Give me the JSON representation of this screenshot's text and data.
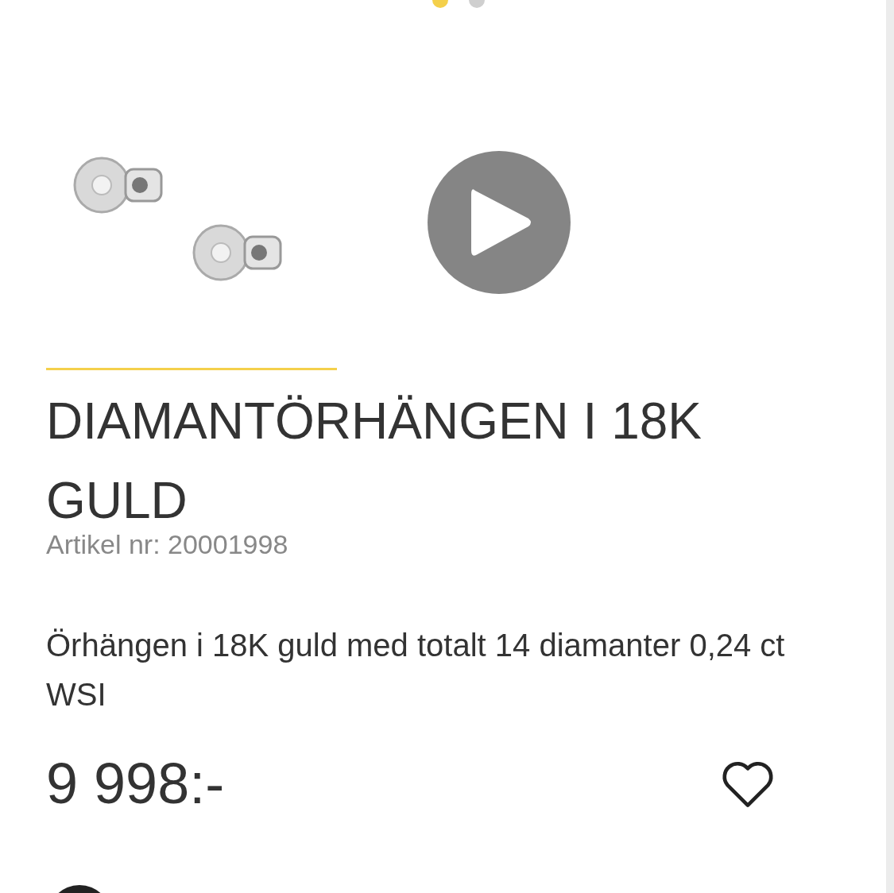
{
  "carousel": {
    "dots": [
      {
        "selected": true
      },
      {
        "selected": false
      }
    ]
  },
  "product": {
    "title": "DIAMANTÖRHÄNGEN I 18K GULD",
    "article": "Artikel nr: 20001998",
    "description": "Örhängen i 18K guld med totalt 14 diamanter 0,24 ct WSI",
    "price": "9 998:-",
    "favorite": false
  }
}
